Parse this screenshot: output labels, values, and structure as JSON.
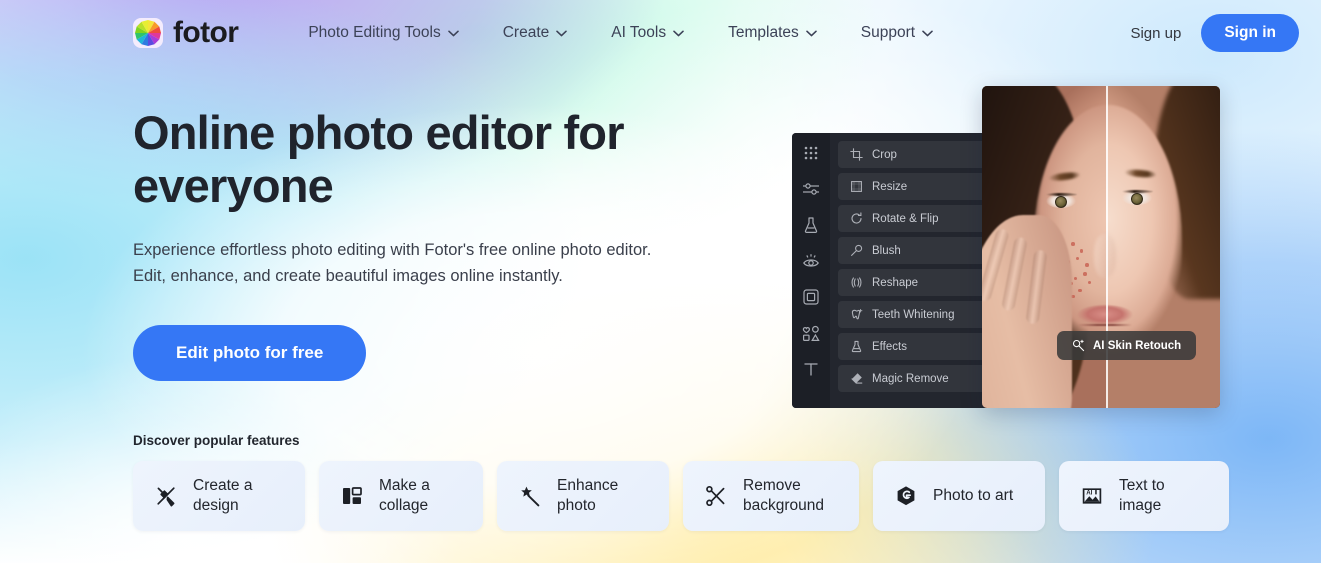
{
  "brand": {
    "name": "fotor",
    "logo_icon": "color-wheel-icon"
  },
  "header": {
    "nav": [
      {
        "label": "Photo Editing Tools",
        "caret": "chevron-down-icon"
      },
      {
        "label": "Create",
        "caret": "chevron-down-icon"
      },
      {
        "label": "AI Tools",
        "caret": "chevron-down-icon"
      },
      {
        "label": "Templates",
        "caret": "chevron-down-icon"
      },
      {
        "label": "Support",
        "caret": "chevron-down-icon"
      }
    ],
    "sign_up": "Sign up",
    "sign_in": "Sign in"
  },
  "hero": {
    "headline": "Online photo editor for everyone",
    "subhead": "Experience effortless photo editing with Fotor's free online photo editor. Edit, enhance, and create beautiful images online instantly.",
    "cta": "Edit photo for free"
  },
  "editor_preview": {
    "rail_icons": [
      "grid-dots-icon",
      "adjust-sliders-icon",
      "beauty-flask-icon",
      "eye-retouch-icon",
      "frame-icon",
      "shapes-icon",
      "text-icon"
    ],
    "tools": [
      {
        "label": "Crop",
        "icon": "crop-icon"
      },
      {
        "label": "Resize",
        "icon": "resize-icon"
      },
      {
        "label": "Rotate & Flip",
        "icon": "rotate-icon"
      },
      {
        "label": "Blush",
        "icon": "blush-icon"
      },
      {
        "label": "Reshape",
        "icon": "reshape-icon"
      },
      {
        "label": "Teeth Whitening",
        "icon": "tooth-icon"
      },
      {
        "label": "Effects",
        "icon": "effects-icon"
      },
      {
        "label": "Magic Remove",
        "icon": "eraser-icon"
      }
    ],
    "tooltip": {
      "label": "AI Skin Retouch",
      "icon": "magic-wand-sparkle-icon"
    }
  },
  "features": {
    "label": "Discover popular features",
    "cards": [
      {
        "label": "Create a\ndesign",
        "icon": "pen-brush-icon",
        "width": 172
      },
      {
        "label": "Make a\ncollage",
        "icon": "collage-icon",
        "width": 164
      },
      {
        "label": "Enhance\nphoto",
        "icon": "magic-wand-icon",
        "width": 172
      },
      {
        "label": "Remove\nbackground",
        "icon": "scissors-icon",
        "width": 176
      },
      {
        "label": "Photo to art",
        "icon": "hexagon-g-icon",
        "width": 172
      },
      {
        "label": "Text to image",
        "icon": "ai-image-icon",
        "width": 170
      }
    ]
  },
  "colors": {
    "accent_blue": "#3577f5",
    "text_dark": "#20242d",
    "text_body": "#3a3f4b",
    "editor_bg": "#23262e",
    "card_bg": "#eef4fd"
  }
}
